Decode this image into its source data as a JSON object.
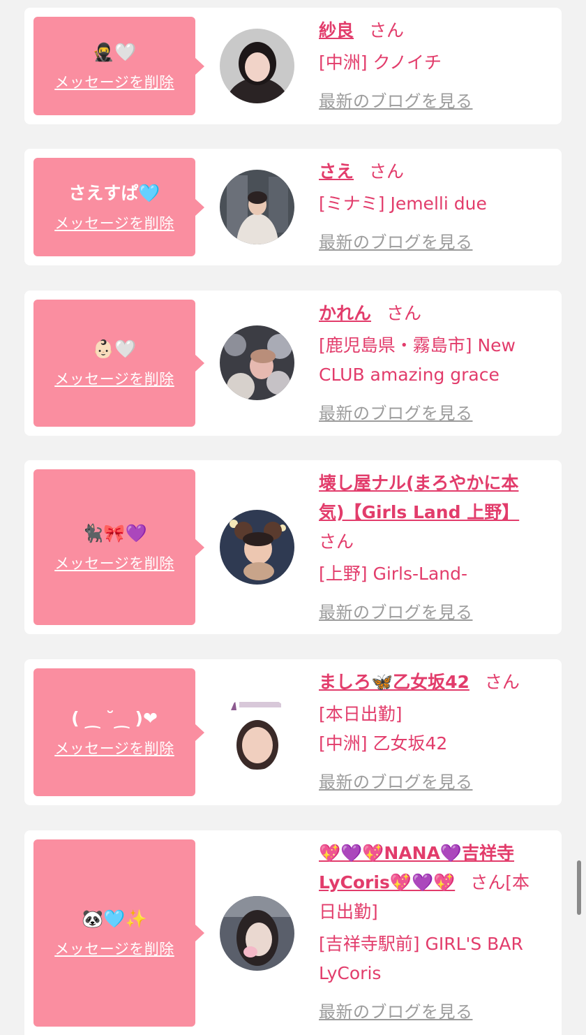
{
  "entries": [
    {
      "message": "🥷🤍",
      "delete_label": "メッセージを削除",
      "name": "紗良",
      "san": "さん",
      "shop_lines": [
        "[中洲] クノイチ"
      ],
      "blog_label": "最新のブログを見る"
    },
    {
      "message": "さえすぱ🩵",
      "delete_label": "メッセージを削除",
      "name": "さえ",
      "san": "さん",
      "shop_lines": [
        "[ミナミ] Jemelli due"
      ],
      "blog_label": "最新のブログを見る"
    },
    {
      "message": "👶🏻🤍",
      "delete_label": "メッセージを削除",
      "name": "かれん",
      "san": "さん",
      "shop_lines": [
        "[鹿児島県・霧島市] New",
        "CLUB amazing grace"
      ],
      "blog_label": "最新のブログを見る"
    },
    {
      "message": "🐈‍⬛🎀💜",
      "delete_label": "メッセージを削除",
      "name_lines": [
        "壊し屋ナル(まろやかに本",
        "気)【Girls Land 上野】"
      ],
      "san": "さん",
      "shop_lines": [
        "[上野] Girls-Land-"
      ],
      "blog_label": "最新のブログを見る"
    },
    {
      "message": "( ⁔ ˘⁔ )❤",
      "delete_label": "メッセージを削除",
      "name": "ましろ🦋乙女坂42",
      "san": "さん",
      "shop_lines": [
        "[本日出勤]",
        "[中洲] 乙女坂42"
      ],
      "blog_label": "最新のブログを見る"
    },
    {
      "message": "🐼🩵✨",
      "delete_label": "メッセージを削除",
      "name_lines": [
        "💖💜💖NANA💜吉祥寺",
        "LyCoris💖💜💖"
      ],
      "san": "さん[本",
      "shop_lines": [
        "日出勤]",
        "[吉祥寺駅前] GIRL'S BAR",
        "LyCoris"
      ],
      "blog_label": "最新のブログを見る"
    }
  ],
  "avatars": [
    {
      "icon": "avatar-photo",
      "colors": [
        "#c9c9c9",
        "#2a2324"
      ]
    },
    {
      "icon": "avatar-photo",
      "colors": [
        "#4a5057",
        "#e8e2dc"
      ]
    },
    {
      "icon": "avatar-photo",
      "colors": [
        "#3c3d44",
        "#d7d1cc"
      ]
    },
    {
      "icon": "avatar-photo",
      "colors": [
        "#2f3a52",
        "#c8a48a"
      ]
    },
    {
      "icon": "avatar-photo",
      "colors": [
        "#ffffff",
        "#8c5a8f"
      ]
    },
    {
      "icon": "avatar-photo",
      "colors": [
        "#5a5f6b",
        "#ead8d0"
      ]
    }
  ],
  "colors": {
    "accent": "#e23c6b",
    "bubble": "#fa8ea0",
    "muted": "#9c9c9c",
    "background": "#f2f2f2"
  }
}
